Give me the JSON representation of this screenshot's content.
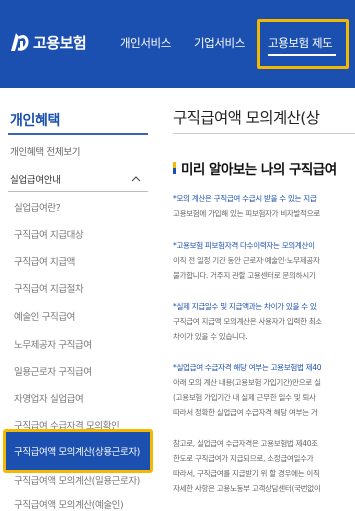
{
  "header": {
    "logo_text": "고용보험",
    "nav": [
      {
        "label": "개인서비스"
      },
      {
        "label": "기업서비스"
      },
      {
        "label": "고용보험 제도"
      }
    ],
    "brand_color": "#1b4fb0",
    "highlight_color": "#f5b800"
  },
  "sidebar": {
    "title": "개인혜택",
    "all_link": "개인혜택 전체보기",
    "group_label": "실업급여안내",
    "items": [
      {
        "label": "실업급여란?"
      },
      {
        "label": "구직급여 지급대상"
      },
      {
        "label": "구직급여 지급액"
      },
      {
        "label": "구직급여 지급절차"
      },
      {
        "label": "예술인 구직급여"
      },
      {
        "label": "노무제공자 구직급여"
      },
      {
        "label": "일용근로자 구직급여"
      },
      {
        "label": "자영업자 실업급여"
      },
      {
        "label": "구직급여 수급자격 모의확인"
      },
      {
        "label": "구직급여액 모의계산(상용근로자)"
      },
      {
        "label": "구직급여액 모의계산(일용근로자)"
      },
      {
        "label": "구직급여액 모의계산(예술인)"
      }
    ],
    "active_index": 9
  },
  "main": {
    "title": "구직급여액 모의계산(상",
    "section_title": "미리 알아보는 나의 구직급여",
    "paragraphs": [
      {
        "lines": [
          {
            "text": "*모의 계산은 구직급여 수급시 받을 수 있는 지급",
            "style": "blue"
          },
          {
            "text": "고용보험에 가입해 있는 피보험자가 비자발적으로",
            "style": "gray"
          }
        ]
      },
      {
        "lines": [
          {
            "text": "*고용보험 피보험자격 다수이력자는 모의계산이",
            "style": "blue"
          },
          {
            "text": "이직 전 일정 기간 동안 근로자·예술인·노무제공자",
            "style": "gray"
          },
          {
            "text": "불가합니다. 거주지 관할 고용센터로 문의하시기",
            "style": "gray"
          }
        ]
      },
      {
        "lines": [
          {
            "text": "*실제 지급일수 및 지급액과는 차이가 있을 수 있",
            "style": "blue"
          },
          {
            "text": "구직급여 지급액 모의계산은 사용자가 입력한 최소",
            "style": "gray"
          },
          {
            "text": "차이가 있을 수 있습니다.",
            "style": "gray"
          }
        ]
      },
      {
        "lines": [
          {
            "text": "*실업급여 수급자격 해당 여부는 고용보험법 제40",
            "style": "blue"
          },
          {
            "text": "아래 모의 계산 내용(고용보험 가입기간)만으로 실",
            "style": "gray"
          },
          {
            "text": "(고용보험 가입기간 내 실제 근무한 일수 및 퇴사",
            "style": "gray"
          },
          {
            "text": "따라서 정확한 실업급여 수급자격 해당 여부는 거",
            "style": "gray"
          }
        ]
      },
      {
        "lines": [
          {
            "text": "참고로, 실업급여 수급자격은 고용보험법 제40조",
            "style": "gray"
          },
          {
            "text": "한도로 구직급여가 지급되므로, 소정급여일수가",
            "style": "gray"
          },
          {
            "text": "따라서, 구직급여를 지급받기 위 할 경우에는 이직",
            "style": "gray"
          },
          {
            "text": "자세한 사항은 고용노동부 고객상담센터(국번없이",
            "style": "gray"
          }
        ]
      }
    ]
  }
}
